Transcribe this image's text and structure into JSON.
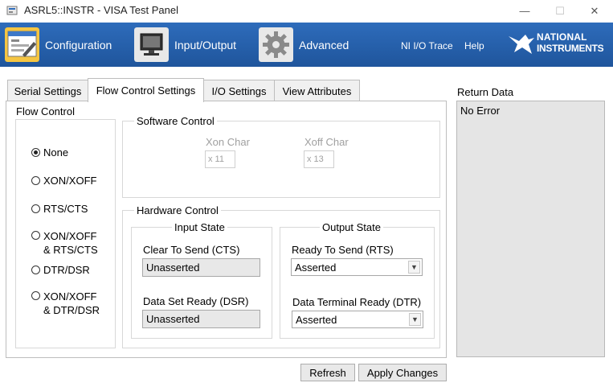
{
  "window": {
    "title": "ASRL5::INSTR - VISA Test Panel",
    "minimize_glyph": "—",
    "maximize_glyph": "☐",
    "close_glyph": "✕"
  },
  "toolbar": {
    "configuration_label": "Configuration",
    "io_label": "Input/Output",
    "advanced_label": "Advanced",
    "ni_io_trace_label": "NI I/O Trace",
    "help_label": "Help",
    "logo_line1": "NATIONAL",
    "logo_line2": "INSTRUMENTS"
  },
  "tabs": [
    {
      "label": "Serial Settings"
    },
    {
      "label": "Flow Control Settings"
    },
    {
      "label": "I/O Settings"
    },
    {
      "label": "View Attributes"
    }
  ],
  "flow_control": {
    "title": "Flow Control",
    "options": [
      {
        "line1": "None",
        "line2": "",
        "selected": true
      },
      {
        "line1": "XON/XOFF",
        "line2": "",
        "selected": false
      },
      {
        "line1": "RTS/CTS",
        "line2": "",
        "selected": false
      },
      {
        "line1": "XON/XOFF",
        "line2": "& RTS/CTS",
        "selected": false
      },
      {
        "line1": "DTR/DSR",
        "line2": "",
        "selected": false
      },
      {
        "line1": "XON/XOFF",
        "line2": "& DTR/DSR",
        "selected": false
      }
    ]
  },
  "software_control": {
    "title": "Software Control",
    "xon_label": "Xon Char",
    "xon_value": "x 11",
    "xoff_label": "Xoff Char",
    "xoff_value": "x 13"
  },
  "hardware_control": {
    "title": "Hardware Control",
    "input_state": {
      "title": "Input State",
      "cts_label": "Clear To Send (CTS)",
      "cts_value": "Unasserted",
      "dsr_label": "Data Set Ready (DSR)",
      "dsr_value": "Unasserted"
    },
    "output_state": {
      "title": "Output State",
      "rts_label": "Ready To Send (RTS)",
      "rts_value": "Asserted",
      "dtr_label": "Data Terminal Ready (DTR)",
      "dtr_value": "Asserted"
    }
  },
  "return_data": {
    "title": "Return Data",
    "value": "No Error"
  },
  "buttons": {
    "refresh": "Refresh",
    "apply": "Apply Changes"
  },
  "colors": {
    "toolbar": "#235ea9",
    "panel_bg": "#e5e5e5"
  }
}
